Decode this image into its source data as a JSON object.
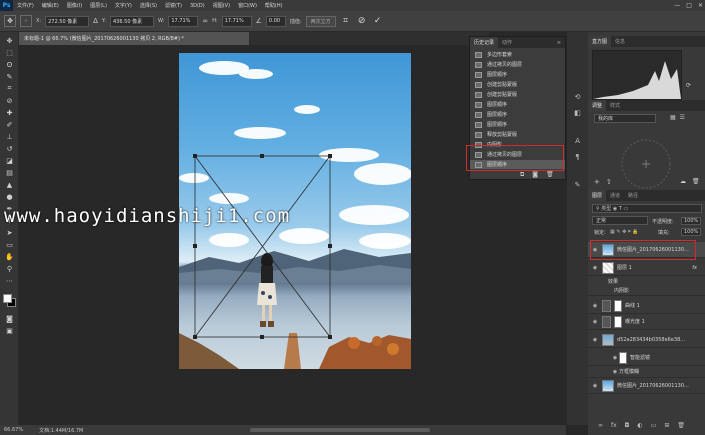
{
  "menubar": {
    "app_logo": "Ps",
    "items": [
      "文件(F)",
      "编辑(E)",
      "图像(I)",
      "图层(L)",
      "文字(Y)",
      "选择(S)",
      "滤镜(T)",
      "3D(D)",
      "视图(V)",
      "窗口(W)",
      "帮助(H)"
    ],
    "window_controls": [
      "—",
      "□",
      "✕"
    ]
  },
  "options": {
    "x_label": "X:",
    "x_value": "272.50 像素",
    "y_label": "Y:",
    "y_value": "436.50 像素",
    "w_label": "W:",
    "w_value": "17.71%",
    "h_label": "H:",
    "h_value": "17.71%",
    "angle_value": "0.00",
    "interp_label": "插值:",
    "warp_label": "两次立方",
    "cancel_symbol": "⊘",
    "commit_symbol": "✓"
  },
  "document": {
    "tab_title": "未标题-1 @ 66.7% (微信图片_20170626001130 拷贝 2, RGB/8#) *"
  },
  "watermark": "www.haoyidianshiji1.com",
  "history": {
    "tabs": [
      "历史记录",
      "动作"
    ],
    "menu_icon": "≡",
    "items": [
      "多边形套索",
      "通过拷贝的图层",
      "图层顺序",
      "创建剪贴蒙版",
      "创建剪贴蒙版",
      "图层顺序",
      "图层顺序",
      "图层顺序",
      "释放剪贴蒙版",
      "内阴影",
      "通过拷贝的图层",
      "图层顺序"
    ],
    "selected_index": 11
  },
  "right_dock": {
    "histogram_tabs": [
      "直方图",
      "信息"
    ],
    "adjust_tabs": [
      "调整",
      "样式"
    ],
    "adjust_sub": "颜色",
    "library_label": "我的库",
    "layers_tabs": [
      "图层",
      "通道",
      "路径"
    ],
    "blend_mode": "正常",
    "opacity_label": "不透明度:",
    "opacity_value": "100%",
    "lock_label": "锁定:",
    "fill_label": "填充:",
    "fill_value": "100%",
    "layers": [
      {
        "name": "微信图片_20170626001130...",
        "kind": "photo",
        "selected": true
      },
      {
        "name": "图层 1",
        "kind": "layer",
        "fx": "fx"
      },
      {
        "name": "效果",
        "kind": "effects"
      },
      {
        "name": "内阴影",
        "kind": "effect"
      },
      {
        "name": "曲线 1",
        "kind": "adjust"
      },
      {
        "name": "曝光度 1",
        "kind": "adjust"
      },
      {
        "name": "d52a283434b0358e6e38...",
        "kind": "smart"
      },
      {
        "name": "智能滤镜",
        "kind": "filter"
      },
      {
        "name": "方框模糊",
        "kind": "filter"
      },
      {
        "name": "微信图片_20170626001130...",
        "kind": "photo"
      }
    ]
  },
  "status": {
    "zoom": "66.67%",
    "doc_info": "文档:1.44M/16.7M"
  },
  "colors": {
    "selection_red": "#d22b2b",
    "panel_bg": "#393939",
    "accent_blue": "#31a8ff"
  }
}
